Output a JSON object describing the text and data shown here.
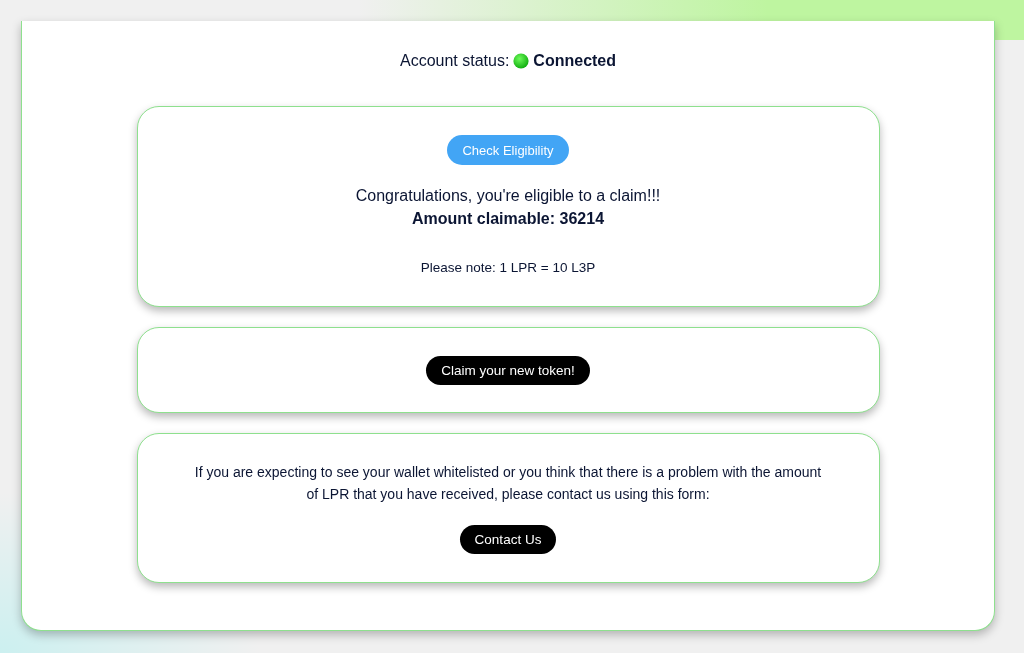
{
  "account_status": {
    "label": "Account status:",
    "connected": true,
    "status": "Connected"
  },
  "eligibility_card": {
    "button": "Check Eligibility",
    "message": "Congratulations, you're eligible to a claim!!!",
    "amount": "Amount claimable: 36214",
    "note": "Please note: 1 LPR = 10 L3P"
  },
  "claim_card": {
    "button": "Claim your new token!"
  },
  "contact_card": {
    "text": "If you are expecting to see your wallet whitelisted or you think that there is a problem with the amount of LPR that you have received, please contact us using this form:",
    "button": "Contact Us"
  }
}
